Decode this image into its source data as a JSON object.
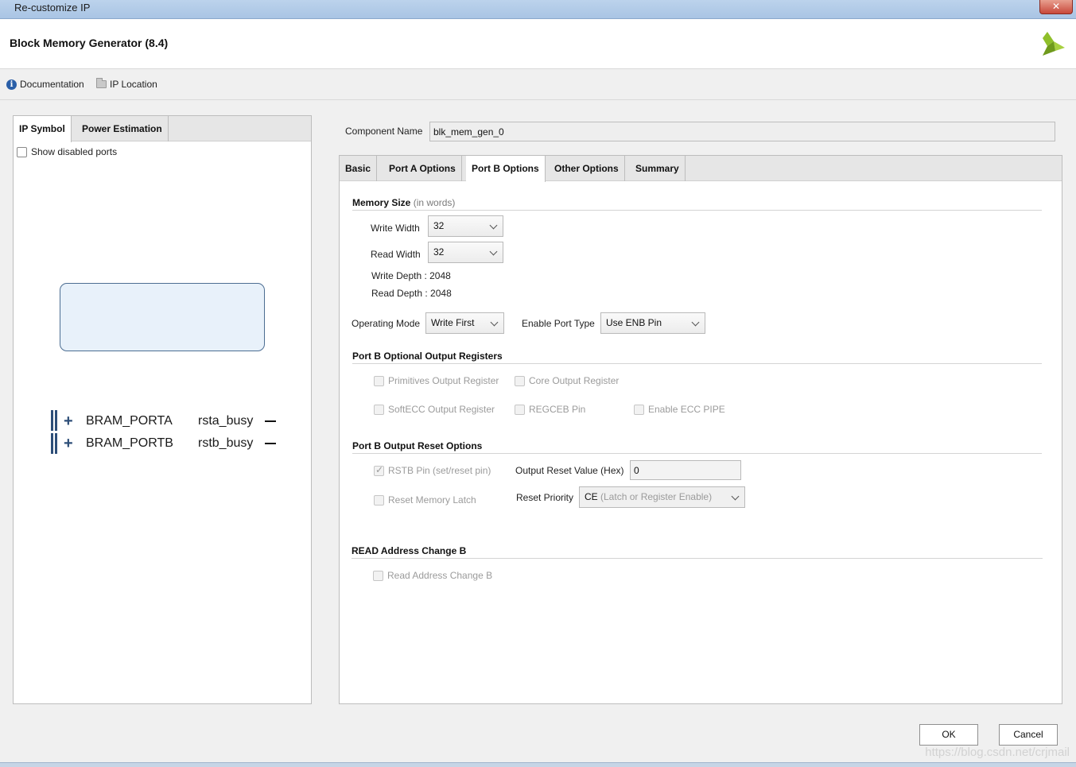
{
  "window": {
    "title": "Re-customize IP",
    "close_label": "✕"
  },
  "header": {
    "title": "Block Memory Generator (8.4)"
  },
  "links": {
    "documentation": "Documentation",
    "ip_location": "IP Location"
  },
  "left_panel": {
    "tabs": [
      {
        "label": "IP Symbol",
        "active": true
      },
      {
        "label": "Power Estimation",
        "active": false
      }
    ],
    "show_disabled_ports": {
      "label": "Show disabled ports",
      "checked": false
    },
    "symbol": {
      "ports": [
        {
          "name": "BRAM_PORTA",
          "output": "rsta_busy"
        },
        {
          "name": "BRAM_PORTB",
          "output": "rstb_busy"
        }
      ],
      "plus_glyph": "+"
    }
  },
  "component": {
    "label": "Component Name",
    "value": "blk_mem_gen_0"
  },
  "tabs": [
    {
      "label": "Basic",
      "active": false
    },
    {
      "label": "Port A Options",
      "active": false
    },
    {
      "label": "Port B Options",
      "active": true
    },
    {
      "label": "Other Options",
      "active": false
    },
    {
      "label": "Summary",
      "active": false
    }
  ],
  "memory_size": {
    "title": "Memory Size",
    "subtitle": "(in words)",
    "write_width_label": "Write Width",
    "write_width": "32",
    "read_width_label": "Read Width",
    "read_width": "32",
    "write_depth": "Write Depth : 2048",
    "read_depth": "Read Depth : 2048"
  },
  "operating": {
    "mode_label": "Operating Mode",
    "mode": "Write First",
    "enable_label": "Enable Port Type",
    "enable": "Use ENB Pin"
  },
  "optional_registers": {
    "title": "Port B Optional Output Registers",
    "primitives": "Primitives Output Register",
    "core": "Core Output Register",
    "softecc": "SoftECC Output Register",
    "regceb": "REGCEB Pin",
    "ecc_pipe": "Enable ECC PIPE"
  },
  "reset_options": {
    "title": "Port B Output Reset Options",
    "rstb_pin": "RSTB Pin (set/reset pin)",
    "rstb_checked": true,
    "reset_value_label": "Output Reset Value (Hex)",
    "reset_value": "0",
    "reset_latch": "Reset Memory Latch",
    "priority_label": "Reset Priority",
    "priority_main": "CE",
    "priority_sub": "(Latch or Register Enable)"
  },
  "address_change": {
    "title": "READ Address Change B",
    "checkbox": "Read Address Change B"
  },
  "buttons": {
    "ok": "OK",
    "cancel": "Cancel"
  },
  "watermark": "https://blog.csdn.net/crjmail",
  "colors": {
    "accent": "#2d4e78",
    "symbol_fill": "#e8f1fa",
    "logo": "#8fbf2a"
  }
}
